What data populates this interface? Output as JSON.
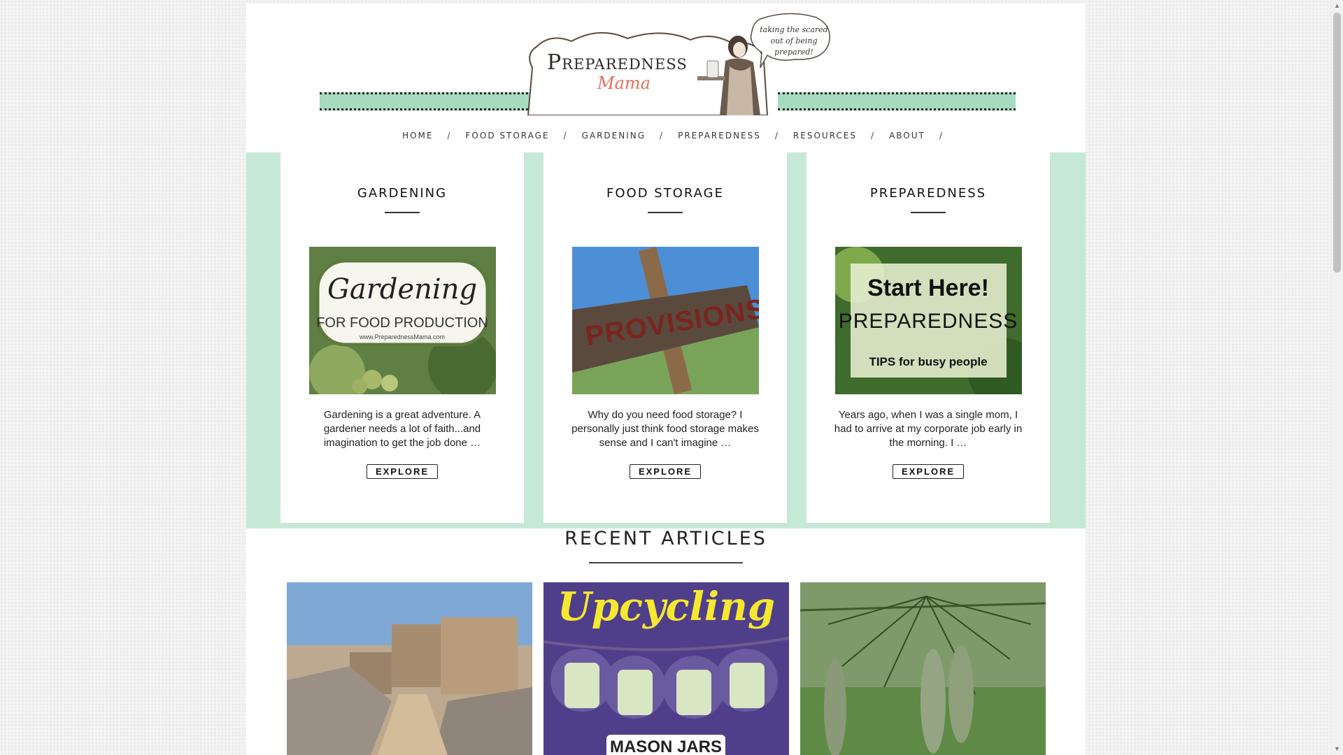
{
  "logo": {
    "title": "Preparedness",
    "subtitle": "Mama",
    "tagline": "taking the scared out of being prepared!"
  },
  "nav": {
    "items": [
      "HOME",
      "FOOD STORAGE",
      "GARDENING",
      "PREPAREDNESS",
      "RESOURCES",
      "ABOUT"
    ],
    "separator": "/"
  },
  "cards": [
    {
      "title": "GARDENING",
      "image_title": "Gardening",
      "image_sub": "FOR FOOD PRODUCTION",
      "image_url_text": "www.PreparednessMama.com",
      "excerpt": "Gardening is a great adventure. A gardener needs a lot of faith...and imagination to get the job done …",
      "button": "EXPLORE"
    },
    {
      "title": "FOOD STORAGE",
      "image_title": "PROVISIONS",
      "excerpt": "Why do you need food storage? I personally just think food storage makes sense and I can't imagine …",
      "button": "EXPLORE"
    },
    {
      "title": "PREPAREDNESS",
      "image_title": "Start Here!",
      "image_sub": "PREPAREDNESS",
      "image_tag": "TIPS for busy people",
      "excerpt": "Years ago, when I was a single mom, I had to arrive at my corporate job early in the morning. I …",
      "button": "EXPLORE"
    }
  ],
  "recent": {
    "title": "RECENT ARTICLES",
    "articles": [
      {
        "image": "destroyed-city-photo"
      },
      {
        "image": "upcycling-mason-jars-graphic",
        "title": "Upcycling",
        "subtitle": "MASON JARS"
      },
      {
        "image": "pine-cones-photo"
      }
    ]
  },
  "colors": {
    "mint": "#c6e9d7",
    "stripe": "#a6dbbe",
    "logo_accent": "#e26d5a"
  }
}
